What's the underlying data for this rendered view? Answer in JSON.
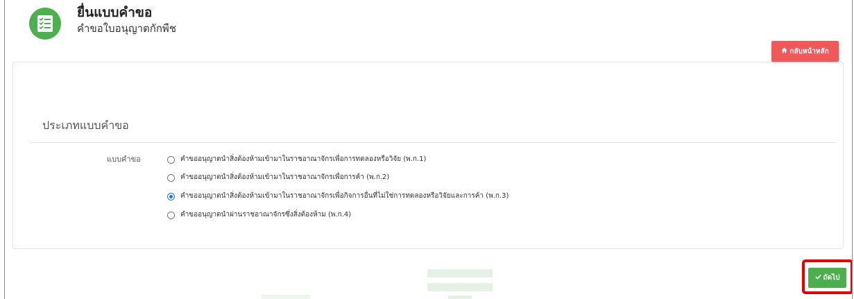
{
  "header": {
    "title": "ยื่นแบบคำขอ",
    "subtitle": "คำขอใบอนุญาตกักพืช",
    "icon": "checklist-icon",
    "icon_color": "#4caf50"
  },
  "toolbar": {
    "home_label": "กลับหน้าหลัก",
    "home_icon": "home-icon",
    "home_color": "#f0585a"
  },
  "form": {
    "section_title": "ประเภทแบบคำขอ",
    "field_label": "แบบคำขอ",
    "options": [
      {
        "label": "คำขออนุญาตนำสิ่งต้องห้ามเข้ามาในราชอาณาจักรเพื่อการทดลองหรือวิจัย (พ.ก.1)",
        "selected": false
      },
      {
        "label": "คำขออนุญาตนำสิ่งต้องห้ามเข้ามาในราชอาณาจักรเพื่อการค้า (พ.ก.2)",
        "selected": false
      },
      {
        "label": "คำขออนุญาตนำสิ่งต้องห้ามเข้ามาในราชอาณาจักรเพื่อกิจการอื่นที่ไม่ใช่การทดลองหรือวิจัยและการค้า (พ.ก.3)",
        "selected": true
      },
      {
        "label": "คำขออนุญาตนำผ่านราชอาณาจักรซึ่งสิ่งต้องห้าม (พ.ก.4)",
        "selected": false
      }
    ]
  },
  "footer": {
    "next_label": "ถัดไป",
    "next_icon": "check-icon",
    "next_color": "#4cae4c",
    "highlight_color": "#e60000"
  }
}
